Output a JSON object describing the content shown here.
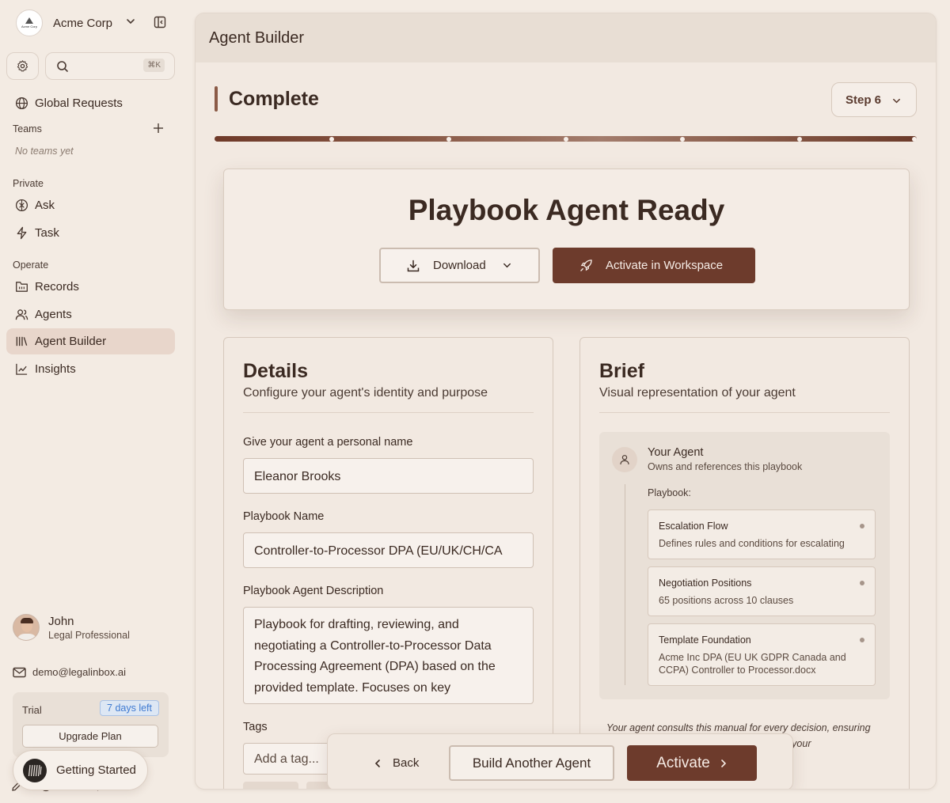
{
  "org": {
    "name": "Acme Corp",
    "logo_text": "Acme Corp"
  },
  "search": {
    "shortcut": "⌘K"
  },
  "sidebar": {
    "global_requests": "Global Requests",
    "teams_label": "Teams",
    "no_teams": "No teams yet",
    "private_label": "Private",
    "ask": "Ask",
    "task": "Task",
    "operate_label": "Operate",
    "records": "Records",
    "agents": "Agents",
    "agent_builder": "Agent Builder",
    "insights": "Insights"
  },
  "user": {
    "name": "John",
    "role": "Legal Professional",
    "email": "demo@legalinbox.ai"
  },
  "trial": {
    "label": "Trial",
    "days_left": "7 days left",
    "upgrade": "Upgrade Plan"
  },
  "getting_started": "Getting Started",
  "header": {
    "title": "Agent Builder"
  },
  "step": {
    "title": "Complete",
    "selector": "Step 6"
  },
  "progress": {
    "current_step": 6,
    "total_steps": 6,
    "fraction": 1.0
  },
  "ready": {
    "title": "Playbook Agent Ready",
    "download": "Download",
    "activate_ws": "Activate in Workspace"
  },
  "details": {
    "title": "Details",
    "subtitle": "Configure your agent's identity and purpose",
    "name_label": "Give your agent a personal name",
    "name_value": "Eleanor Brooks",
    "playbook_label": "Playbook Name",
    "playbook_value": "Controller-to-Processor DPA (EU/UK/CH/CA",
    "desc_label": "Playbook Agent Description",
    "desc_value": "Playbook for drafting, reviewing, and negotiating a Controller-to-Processor Data Processing Agreement (DPA) based on the provided template. Focuses on key",
    "tags_label": "Tags",
    "tags_placeholder": "Add a tag..."
  },
  "brief": {
    "title": "Brief",
    "subtitle": "Visual representation of your agent",
    "agent_name": "Your Agent",
    "agent_sub": "Owns and references this playbook",
    "playbook_label": "Playbook:",
    "items": [
      {
        "title": "Escalation Flow",
        "desc": "Defines rules and conditions for escalating"
      },
      {
        "title": "Negotiation Positions",
        "desc": "65 positions across 10 clauses"
      },
      {
        "title": "Template Foundation",
        "desc": "Acme Inc DPA (EU UK GDPR Canada and CCPA) Controller to Processor.docx"
      }
    ],
    "note": "Your agent consults this manual for every decision, ensuring consistent, compliant handling throughout your"
  },
  "actions": {
    "back": "Back",
    "build_another": "Build Another Agent",
    "activate": "Activate"
  },
  "colors": {
    "accent": "#6d3b2c",
    "background": "#f3ebe3",
    "active_nav": "#e8d6cb",
    "trial_badge": "#3f7ad1"
  }
}
